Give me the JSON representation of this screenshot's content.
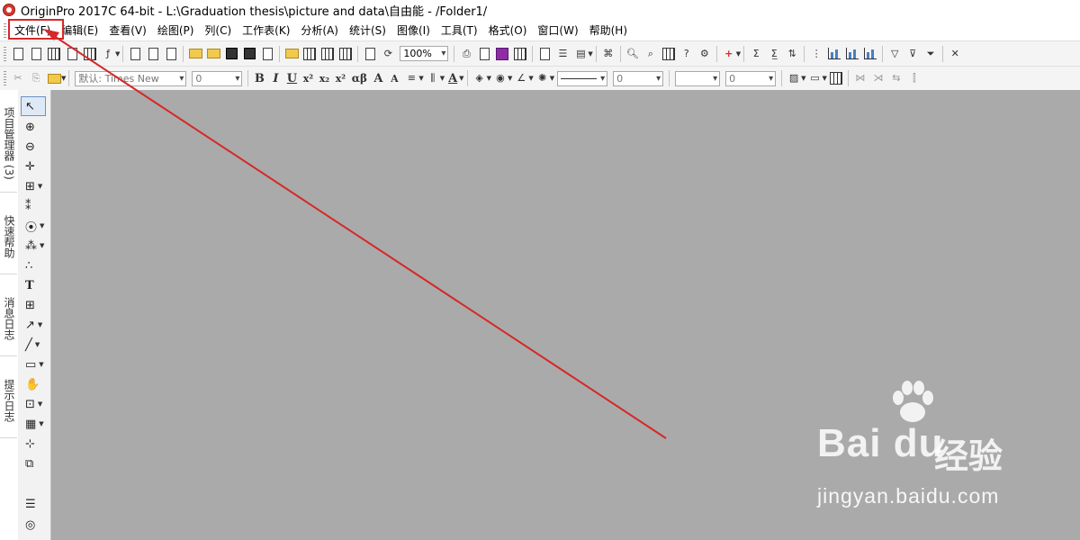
{
  "window": {
    "title": "OriginPro 2017C 64-bit - L:\\Graduation thesis\\picture and data\\自由能 - /Folder1/"
  },
  "menu": [
    {
      "label": "文件(F)"
    },
    {
      "label": "编辑(E)"
    },
    {
      "label": "查看(V)"
    },
    {
      "label": "绘图(P)"
    },
    {
      "label": "列(C)"
    },
    {
      "label": "工作表(K)"
    },
    {
      "label": "分析(A)"
    },
    {
      "label": "统计(S)"
    },
    {
      "label": "图像(I)"
    },
    {
      "label": "工具(T)"
    },
    {
      "label": "格式(O)"
    },
    {
      "label": "窗口(W)"
    },
    {
      "label": "帮助(H)"
    }
  ],
  "toolbar": {
    "zoom": "100%",
    "font_name": "默认: Times New",
    "font_size": "0",
    "line_width": "0",
    "border_width": "0"
  },
  "side_tabs": [
    {
      "label": "项目管理器 (3)"
    },
    {
      "label": "快速帮助"
    },
    {
      "label": "消息日志"
    },
    {
      "label": "提示日志"
    }
  ],
  "annotation": {
    "color": "#d62828"
  },
  "watermark": {
    "logo": "Bai du",
    "cn": "经验",
    "url": "jingyan.baidu.com"
  }
}
